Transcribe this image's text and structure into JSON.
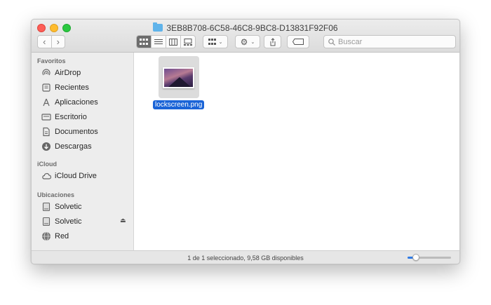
{
  "window": {
    "title": "3EB8B708-6C58-46C8-9BC8-D13831F92F06"
  },
  "toolbar": {
    "back_icon": "chevron-left-icon",
    "forward_icon": "chevron-right-icon",
    "view_modes": [
      "icon-view",
      "list-view",
      "column-view",
      "gallery-view"
    ],
    "active_view": "icon-view",
    "group_icon": "group-grid-icon",
    "action_icon": "gear-icon",
    "share_icon": "share-icon",
    "tag_icon": "tag-icon"
  },
  "search": {
    "placeholder": "Buscar",
    "value": ""
  },
  "sidebar": {
    "sections": [
      {
        "title": "Favoritos",
        "items": [
          {
            "label": "AirDrop",
            "icon": "airdrop-icon"
          },
          {
            "label": "Recientes",
            "icon": "recents-icon"
          },
          {
            "label": "Aplicaciones",
            "icon": "applications-icon"
          },
          {
            "label": "Escritorio",
            "icon": "desktop-icon"
          },
          {
            "label": "Documentos",
            "icon": "documents-icon"
          },
          {
            "label": "Descargas",
            "icon": "downloads-icon"
          }
        ]
      },
      {
        "title": "iCloud",
        "items": [
          {
            "label": "iCloud Drive",
            "icon": "cloud-icon"
          }
        ]
      },
      {
        "title": "Ubicaciones",
        "items": [
          {
            "label": "Solvetic",
            "icon": "disk-icon"
          },
          {
            "label": "Solvetic",
            "icon": "disk-icon"
          },
          {
            "label": "Red",
            "icon": "network-icon"
          }
        ]
      }
    ]
  },
  "content": {
    "files": [
      {
        "name": "lockscreen.png",
        "selected": true
      }
    ]
  },
  "statusbar": {
    "text": "1 de 1 seleccionado, 9,58 GB disponibles",
    "zoom_level": 0.2
  },
  "colors": {
    "accent": "#1a64d7",
    "close": "#fd5e57",
    "minimize": "#febc2e",
    "maximize": "#2ac840",
    "folder": "#5fb3ea"
  }
}
